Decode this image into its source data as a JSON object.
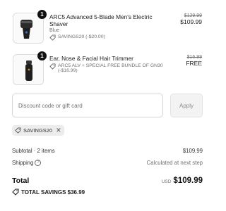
{
  "items": [
    {
      "quantity": "1",
      "name": "ARC5 Advanced 5-Blade Men's Electric Shaver",
      "variant": "Blue",
      "discount": "SAVINGS20 (-$20.00)",
      "original_price": "$129.99",
      "price": "$109.99",
      "icon": "electric-shaver-icon"
    },
    {
      "quantity": "1",
      "name": "Ear, Nose & Facial Hair Trimmer",
      "variant": "",
      "discount": "ARC5 ALV + SPECIAL FREE BUNDLE OF GN30 (-$16.99)",
      "original_price": "$16.99",
      "price": "FREE",
      "icon": "hair-trimmer-icon"
    }
  ],
  "discount_form": {
    "placeholder": "Discount code or gift card",
    "apply_label": "Apply"
  },
  "applied_code": "SAVINGS20",
  "summary": {
    "subtotal_label": "Subtotal · 2 items",
    "subtotal_value": "$109.99",
    "shipping_label": "Shipping",
    "shipping_value": "Calculated at next step",
    "total_label": "Total",
    "currency": "USD",
    "total_value": "$109.99",
    "savings_text": "TOTAL SAVINGS $36.99"
  }
}
